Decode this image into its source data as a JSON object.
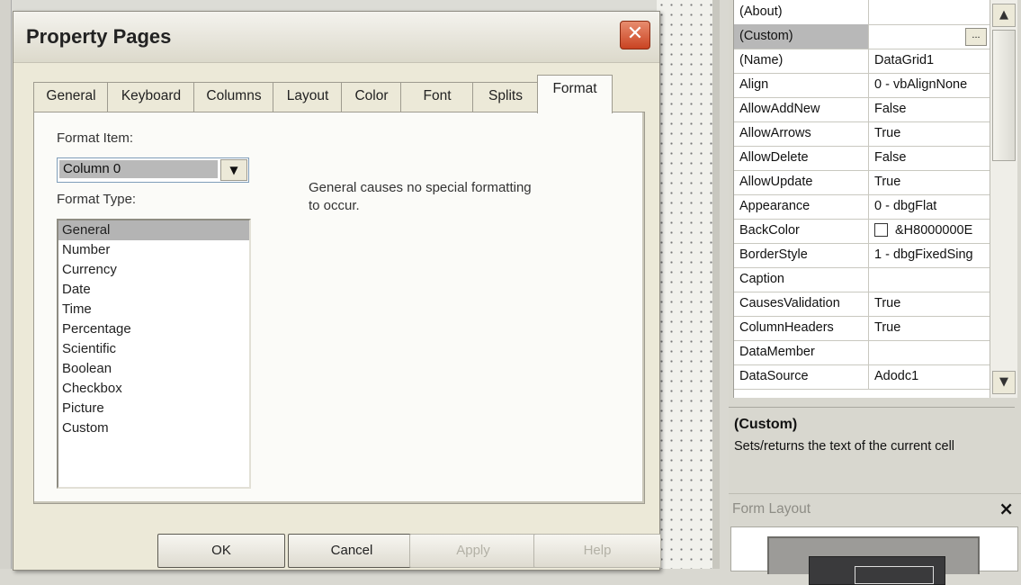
{
  "dialog": {
    "title": "Property Pages",
    "close_icon": "close-icon",
    "tabs": [
      {
        "label": "General"
      },
      {
        "label": "Keyboard"
      },
      {
        "label": "Columns"
      },
      {
        "label": "Layout"
      },
      {
        "label": "Color"
      },
      {
        "label": "Font"
      },
      {
        "label": "Splits"
      },
      {
        "label": "Format"
      }
    ],
    "active_tab": "Format",
    "format_item_label": "Format Item:",
    "format_item_value": "Column 0",
    "format_type_label": "Format Type:",
    "format_types": [
      {
        "label": "General"
      },
      {
        "label": "Number"
      },
      {
        "label": "Currency"
      },
      {
        "label": "Date"
      },
      {
        "label": "Time"
      },
      {
        "label": "Percentage"
      },
      {
        "label": "Scientific"
      },
      {
        "label": "Boolean"
      },
      {
        "label": "Checkbox"
      },
      {
        "label": "Picture"
      },
      {
        "label": "Custom"
      }
    ],
    "selected_format_type": "General",
    "description": "General causes no special formatting to occur.",
    "buttons": {
      "ok": "OK",
      "cancel": "Cancel",
      "apply": "Apply",
      "help": "Help"
    }
  },
  "properties": {
    "rows": [
      {
        "name": "(About)",
        "value": ""
      },
      {
        "name": "(Custom)",
        "value": "",
        "button": "..."
      },
      {
        "name": "(Name)",
        "value": "DataGrid1"
      },
      {
        "name": "Align",
        "value": "0 - vbAlignNone"
      },
      {
        "name": "AllowAddNew",
        "value": "False"
      },
      {
        "name": "AllowArrows",
        "value": "True"
      },
      {
        "name": "AllowDelete",
        "value": "False"
      },
      {
        "name": "AllowUpdate",
        "value": "True"
      },
      {
        "name": "Appearance",
        "value": "0 - dbgFlat"
      },
      {
        "name": "BackColor",
        "value": "&H8000000E",
        "swatch": "#ffffff"
      },
      {
        "name": "BorderStyle",
        "value": "1 - dbgFixedSing"
      },
      {
        "name": "Caption",
        "value": ""
      },
      {
        "name": "CausesValidation",
        "value": "True"
      },
      {
        "name": "ColumnHeaders",
        "value": "True"
      },
      {
        "name": "DataMember",
        "value": ""
      },
      {
        "name": "DataSource",
        "value": "Adodc1"
      }
    ],
    "selected_row": "(Custom)",
    "description_title": "(Custom)",
    "description_text": "Sets/returns the text of the current cell"
  },
  "form_layout": {
    "title": "Form Layout",
    "close_label": "×"
  }
}
